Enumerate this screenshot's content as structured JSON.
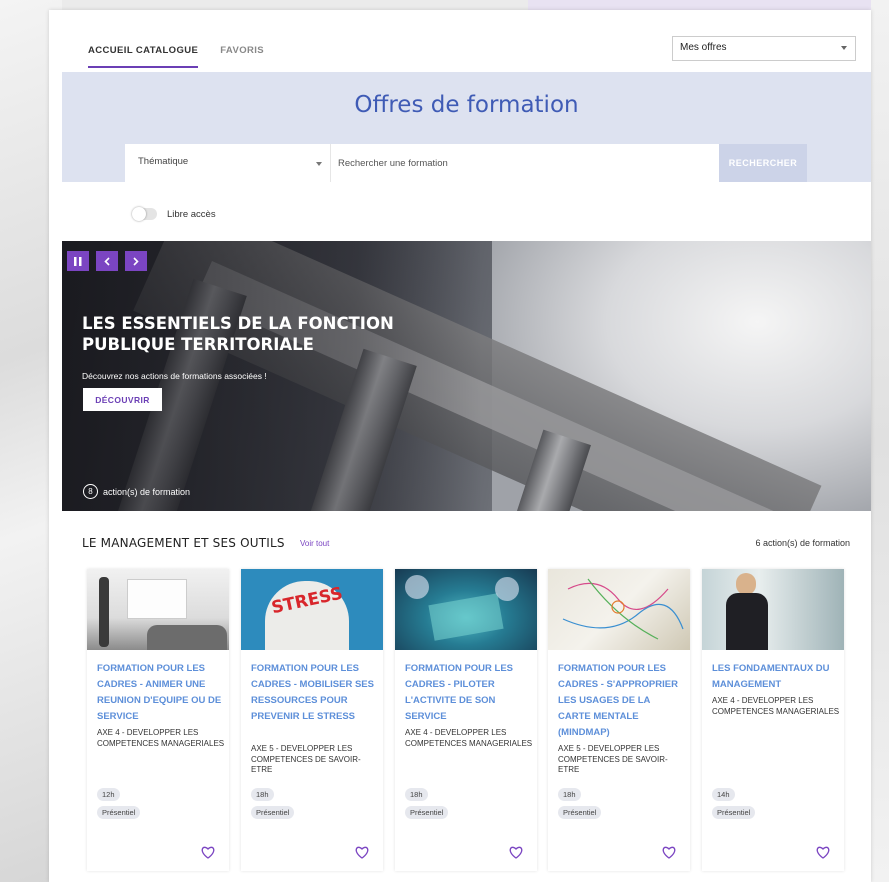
{
  "tabs": [
    {
      "label": "ACCUEIL CATALOGUE",
      "active": true
    },
    {
      "label": "FAVORIS",
      "active": false
    }
  ],
  "offers_select": {
    "value": "Mes offres"
  },
  "search": {
    "title": "Offres de formation",
    "thematique": "Thématique",
    "placeholder": "Rechercher une formation",
    "button": "RECHERCHER"
  },
  "filter": {
    "label": "Libre accès",
    "checked": false
  },
  "hero": {
    "title": "LES ESSENTIELS DE LA FONCTION PUBLIQUE TERRITORIALE",
    "subtitle": "Découvrez nos actions de formations associées !",
    "button": "DÉCOUVRIR",
    "count": "8",
    "count_label": "action(s) de formation"
  },
  "section": {
    "title": "LE MANAGEMENT ET SES OUTILS",
    "see_all": "Voir tout",
    "count": "6 action(s) de formation"
  },
  "cards": [
    {
      "title": "FORMATION POUR LES CADRES - ANIMER UNE REUNION D'EQUIPE OU DE SERVICE",
      "axe": "AXE 4 - DEVELOPPER LES COMPETENCES MANAGERIALES",
      "duration": "12h",
      "mode": "Présentiel"
    },
    {
      "title": "FORMATION POUR LES CADRES - MOBILISER SES RESSOURCES POUR PREVENIR LE STRESS",
      "axe": "AXE 5 - DEVELOPPER LES COMPETENCES DE SAVOIR-ETRE",
      "duration": "18h",
      "mode": "Présentiel"
    },
    {
      "title": "FORMATION POUR LES CADRES - PILOTER L'ACTIVITE DE SON SERVICE",
      "axe": "AXE 4 - DEVELOPPER LES COMPETENCES MANAGERIALES",
      "duration": "18h",
      "mode": "Présentiel"
    },
    {
      "title": "FORMATION POUR LES CADRES - S'APPROPRIER LES USAGES DE LA CARTE MENTALE (MINDMAP)",
      "axe": "AXE 5 - DEVELOPPER LES COMPETENCES DE SAVOIR-ETRE",
      "duration": "18h",
      "mode": "Présentiel"
    },
    {
      "title": "LES FONDAMENTAUX DU MANAGEMENT",
      "axe": "AXE 4 - DEVELOPPER LES COMPETENCES MANAGERIALES",
      "duration": "14h",
      "mode": "Présentiel"
    }
  ],
  "card_image_text": "STRESS",
  "colors": {
    "accent": "#7b45c2",
    "title_blue": "#3f5bb5",
    "card_title": "#5d8fd9",
    "band": "#dde2f0"
  },
  "icons": [
    "pause-icon",
    "chevron-left-icon",
    "chevron-right-icon",
    "heart-icon",
    "chevron-down-icon"
  ]
}
